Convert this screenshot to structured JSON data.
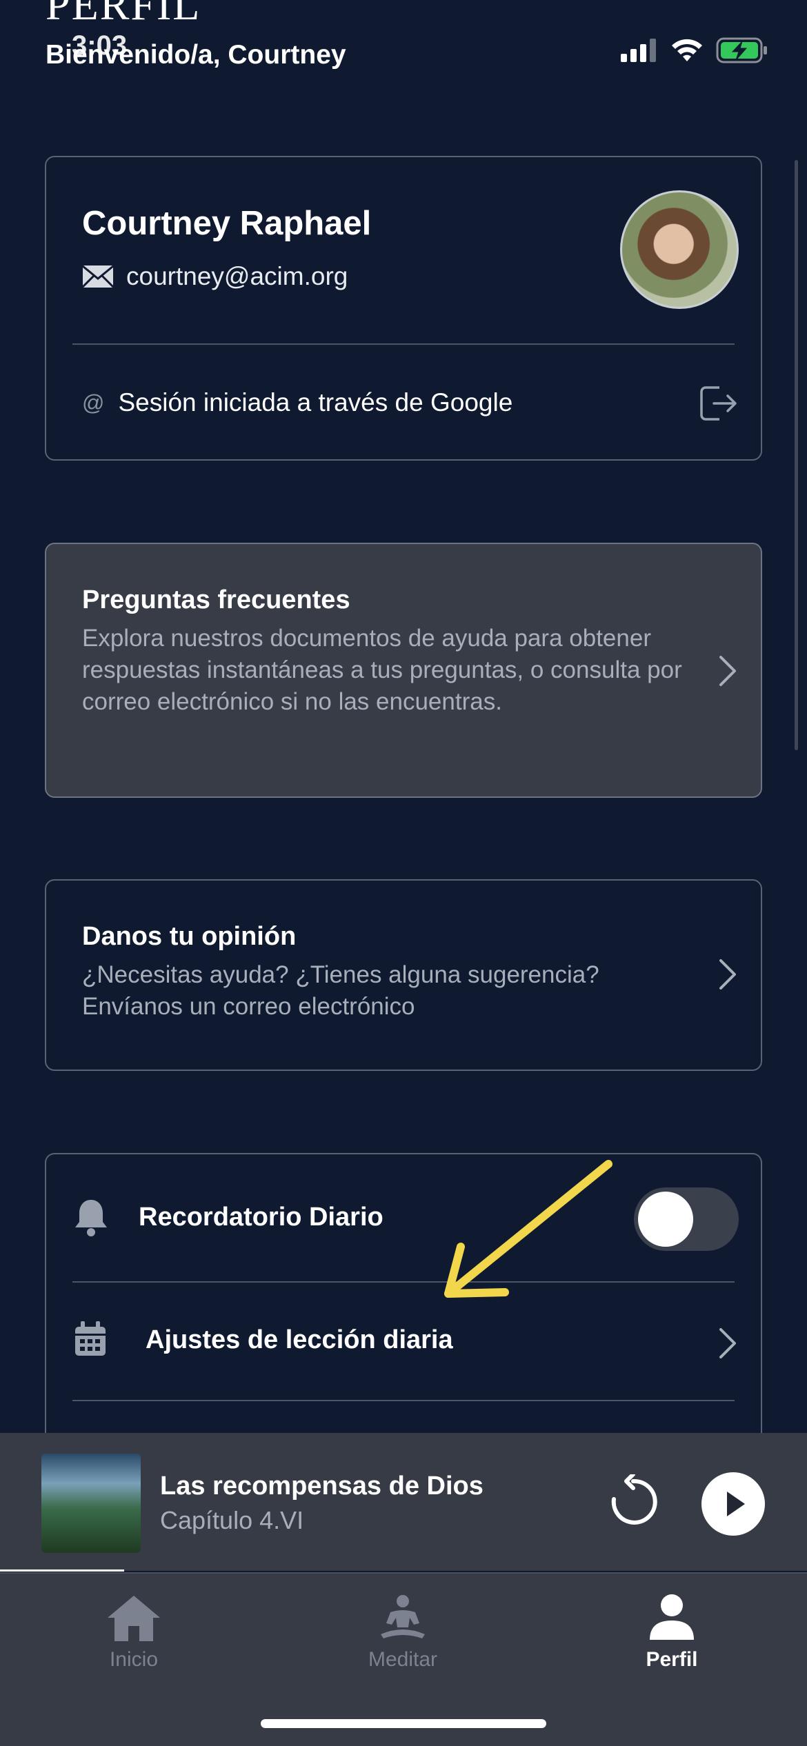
{
  "status_bar": {
    "time": "3:03"
  },
  "header": {
    "page_title": "PERFIL",
    "welcome": "Bienvenido/a, Courtney"
  },
  "profile": {
    "name": "Courtney Raphael",
    "email": "courtney@acim.org",
    "sign_in_method": "Sesión iniciada a través de Google"
  },
  "faq": {
    "title": "Preguntas frecuentes",
    "description": "Explora nuestros documentos de ayuda para obtener respuestas instantáneas a tus preguntas, o consulta por correo electrónico si no las encuentras."
  },
  "feedback": {
    "title": "Danos tu opinión",
    "description": "¿Necesitas ayuda? ¿Tienes alguna sugerencia? Envíanos un correo electrónico"
  },
  "settings": {
    "daily_reminder_label": "Recordatorio Diario",
    "daily_reminder_enabled": false,
    "daily_lesson_label": "Ajustes de lección diaria"
  },
  "player": {
    "title": "Las recompensas de Dios",
    "subtitle": "Capítulo 4.VI"
  },
  "tabs": [
    {
      "label": "Inicio",
      "icon": "home-icon",
      "active": false
    },
    {
      "label": "Meditar",
      "icon": "meditate-icon",
      "active": false
    },
    {
      "label": "Perfil",
      "icon": "person-icon",
      "active": true
    }
  ],
  "colors": {
    "background": "#0f1a30",
    "card_border": "#5a6273",
    "faq_background": "#373c47",
    "muted_text": "#a9afba",
    "annotation_arrow": "#f2d64b",
    "battery_green": "#34c759"
  }
}
